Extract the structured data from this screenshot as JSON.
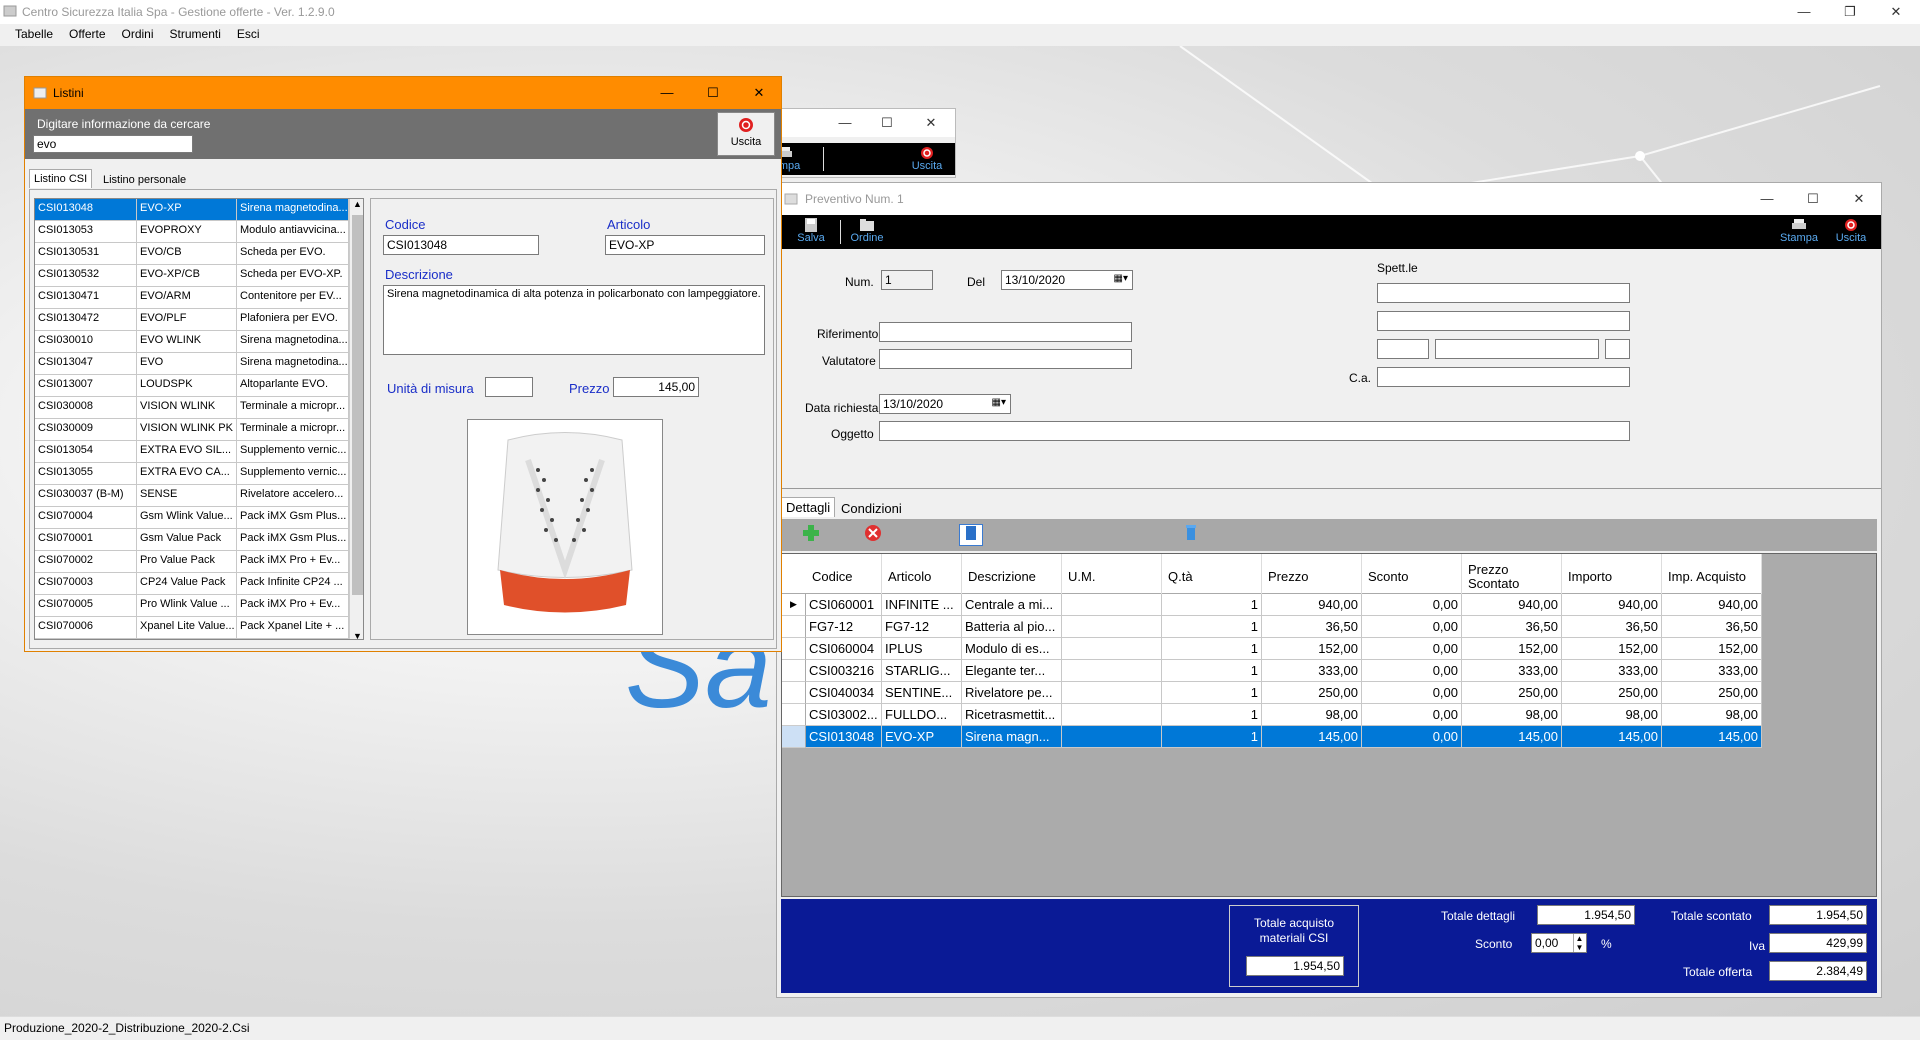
{
  "app": {
    "title": "Centro Sicurezza Italia Spa - Gestione offerte - Ver. 1.2.9.0"
  },
  "menu": [
    "Tabelle",
    "Offerte",
    "Ordini",
    "Strumenti",
    "Esci"
  ],
  "status": "Produzione_2020-2_Distribuzione_2020-2.Csi",
  "bg_logo": "Sa",
  "back_window": {
    "btn_stampa": "Stampa",
    "btn_uscita": "Uscita",
    "stampa_visible": "tampa"
  },
  "listini": {
    "title": "Listini",
    "search_label": "Digitare informazione da cercare",
    "search_value": "evo",
    "uscita": "Uscita",
    "tabs": [
      "Listino CSI",
      "Listino personale"
    ],
    "rows": [
      [
        "CSI013048",
        "EVO-XP",
        "Sirena magnetodina..."
      ],
      [
        "CSI013053",
        "EVOPROXY",
        "Modulo antiavvicina..."
      ],
      [
        "CSI0130531",
        "EVO/CB",
        "Scheda per EVO."
      ],
      [
        "CSI0130532",
        "EVO-XP/CB",
        "Scheda per EVO-XP."
      ],
      [
        "CSI0130471",
        "EVO/ARM",
        "Contenitore per EV..."
      ],
      [
        "CSI0130472",
        "EVO/PLF",
        "Plafoniera per EVO."
      ],
      [
        "CSI030010",
        "EVO WLINK",
        "Sirena magnetodina..."
      ],
      [
        "CSI013047",
        "EVO",
        "Sirena magnetodina..."
      ],
      [
        "CSI013007",
        "LOUDSPK",
        "Altoparlante EVO."
      ],
      [
        "CSI030008",
        "VISION WLINK",
        "Terminale a micropr..."
      ],
      [
        "CSI030009",
        "VISION WLINK PK",
        "Terminale a micropr..."
      ],
      [
        "CSI013054",
        "EXTRA EVO SIL...",
        "Supplemento vernic..."
      ],
      [
        "CSI013055",
        "EXTRA EVO CA...",
        "Supplemento vernic..."
      ],
      [
        "CSI030037 (B-M)",
        "SENSE",
        "Rivelatore accelero..."
      ],
      [
        "CSI070004",
        "Gsm Wlink Value...",
        "Pack iMX Gsm Plus..."
      ],
      [
        "CSI070001",
        "Gsm Value Pack",
        "Pack iMX Gsm Plus..."
      ],
      [
        "CSI070002",
        "Pro Value Pack",
        "Pack iMX Pro + Ev..."
      ],
      [
        "CSI070003",
        "CP24 Value Pack",
        "Pack Infinite CP24 ..."
      ],
      [
        "CSI070005",
        "Pro Wlink Value ...",
        "Pack iMX Pro + Ev..."
      ],
      [
        "CSI070006",
        "Xpanel Lite Value...",
        "Pack Xpanel Lite + ..."
      ]
    ],
    "detail": {
      "codice_label": "Codice",
      "codice": "CSI013048",
      "articolo_label": "Articolo",
      "articolo": "EVO-XP",
      "descrizione_label": "Descrizione",
      "descrizione": "Sirena magnetodinamica di alta potenza in policarbonato con lampeggiatore.",
      "um_label": "Unità di misura",
      "um": "",
      "prezzo_label": "Prezzo",
      "prezzo": "145,00"
    }
  },
  "preventivo": {
    "title": "Preventivo Num. 1",
    "toolbar": {
      "salva": "Salva",
      "ordine": "Ordine",
      "stampa": "Stampa",
      "uscita": "Uscita"
    },
    "num_label": "Num.",
    "num": "1",
    "del_label": "Del",
    "del": "13/10/2020",
    "spett_label": "Spett.le",
    "riferimento_label": "Riferimento",
    "valutatore_label": "Valutatore",
    "ca_label": "C.a.",
    "data_richiesta_label": "Data richiesta",
    "data_richiesta": "13/10/2020",
    "oggetto_label": "Oggetto",
    "tabs": [
      "Dettagli",
      "Condizioni"
    ],
    "columns": [
      "Codice",
      "Articolo",
      "Descrizione",
      "U.M.",
      "Q.tà",
      "Prezzo",
      "Sconto",
      "Prezzo Scontato",
      "Importo",
      "Imp. Acquisto"
    ],
    "rows": [
      [
        "CSI060001",
        "INFINITE ...",
        "Centrale a mi...",
        "",
        "1",
        "940,00",
        "0,00",
        "940,00",
        "940,00",
        "940,00"
      ],
      [
        "FG7-12",
        "FG7-12",
        "Batteria al pio...",
        "",
        "1",
        "36,50",
        "0,00",
        "36,50",
        "36,50",
        "36,50"
      ],
      [
        "CSI060004",
        "IPLUS",
        "Modulo di es...",
        "",
        "1",
        "152,00",
        "0,00",
        "152,00",
        "152,00",
        "152,00"
      ],
      [
        "CSI003216",
        "STARLIG...",
        "Elegante ter...",
        "",
        "1",
        "333,00",
        "0,00",
        "333,00",
        "333,00",
        "333,00"
      ],
      [
        "CSI040034",
        "SENTINE...",
        "Rivelatore pe...",
        "",
        "1",
        "250,00",
        "0,00",
        "250,00",
        "250,00",
        "250,00"
      ],
      [
        "CSI03002...",
        "FULLDO...",
        "Ricetrasmettit...",
        "",
        "1",
        "98,00",
        "0,00",
        "98,00",
        "98,00",
        "98,00"
      ],
      [
        "CSI013048",
        "EVO-XP",
        "Sirena magn...",
        "",
        "1",
        "145,00",
        "0,00",
        "145,00",
        "145,00",
        "145,00"
      ]
    ],
    "totals": {
      "acquisto_label": "Totale acquisto materiali CSI",
      "acquisto": "1.954,50",
      "dettagli_label": "Totale dettagli",
      "dettagli": "1.954,50",
      "sconto_label": "Sconto",
      "sconto": "0,00",
      "pct": "%",
      "scontato_label": "Totale scontato",
      "scontato": "1.954,50",
      "iva_label": "Iva",
      "iva": "429,99",
      "offerta_label": "Totale offerta",
      "offerta": "2.384,49"
    }
  }
}
